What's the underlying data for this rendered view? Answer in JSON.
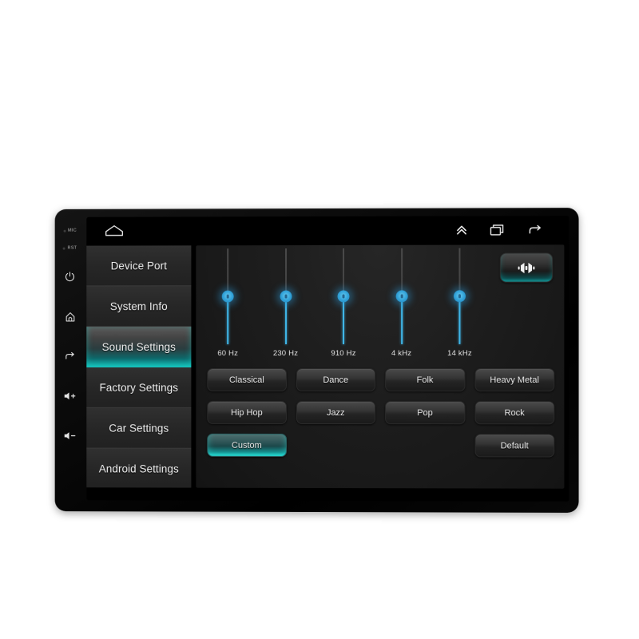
{
  "device": {
    "hardware_labels": {
      "mic": "MIC",
      "rst": "RST"
    },
    "hardware_buttons": [
      {
        "name": "power-button",
        "icon": "power-icon"
      },
      {
        "name": "home-button",
        "icon": "home-icon"
      },
      {
        "name": "back-button",
        "icon": "back-arrow-icon"
      },
      {
        "name": "volume-up-button",
        "icon": "volume-up-icon",
        "label": "+"
      },
      {
        "name": "volume-down-button",
        "icon": "volume-down-icon",
        "label": "-"
      }
    ]
  },
  "navbar": {
    "home_icon": "home-outline-icon",
    "items": [
      {
        "name": "expand-up-button",
        "icon": "double-chevron-up-icon"
      },
      {
        "name": "recent-apps-button",
        "icon": "recent-apps-icon"
      },
      {
        "name": "back-button",
        "icon": "back-arrow-icon"
      }
    ]
  },
  "sidebar": {
    "items": [
      {
        "label": "Device Port",
        "active": false
      },
      {
        "label": "System Info",
        "active": false
      },
      {
        "label": "Sound Settings",
        "active": true
      },
      {
        "label": "Factory Settings",
        "active": false
      },
      {
        "label": "Car Settings",
        "active": false
      },
      {
        "label": "Android Settings",
        "active": false
      }
    ]
  },
  "equalizer": {
    "fader_button": {
      "name": "balance-fader-button",
      "icon": "balance-speakers-icon"
    },
    "bands": [
      {
        "label": "60 Hz",
        "value": 50
      },
      {
        "label": "230 Hz",
        "value": 50
      },
      {
        "label": "910 Hz",
        "value": 50
      },
      {
        "label": "4 kHz",
        "value": 50
      },
      {
        "label": "14 kHz",
        "value": 50
      }
    ],
    "presets": [
      {
        "label": "Classical",
        "active": false
      },
      {
        "label": "Dance",
        "active": false
      },
      {
        "label": "Folk",
        "active": false
      },
      {
        "label": "Heavy Metal",
        "active": false
      },
      {
        "label": "Hip Hop",
        "active": false
      },
      {
        "label": "Jazz",
        "active": false
      },
      {
        "label": "Pop",
        "active": false
      },
      {
        "label": "Rock",
        "active": false
      },
      {
        "label": "Custom",
        "active": true
      },
      {
        "label": "",
        "active": false,
        "empty": true
      },
      {
        "label": "",
        "active": false,
        "empty": true
      },
      {
        "label": "Default",
        "active": false
      }
    ]
  },
  "colors": {
    "accent_teal": "#13b3ae",
    "slider_blue": "#3fb6e8",
    "screen_black": "#000000",
    "panel_dark": "#1d1d1d",
    "page_background": "#ffffff"
  }
}
